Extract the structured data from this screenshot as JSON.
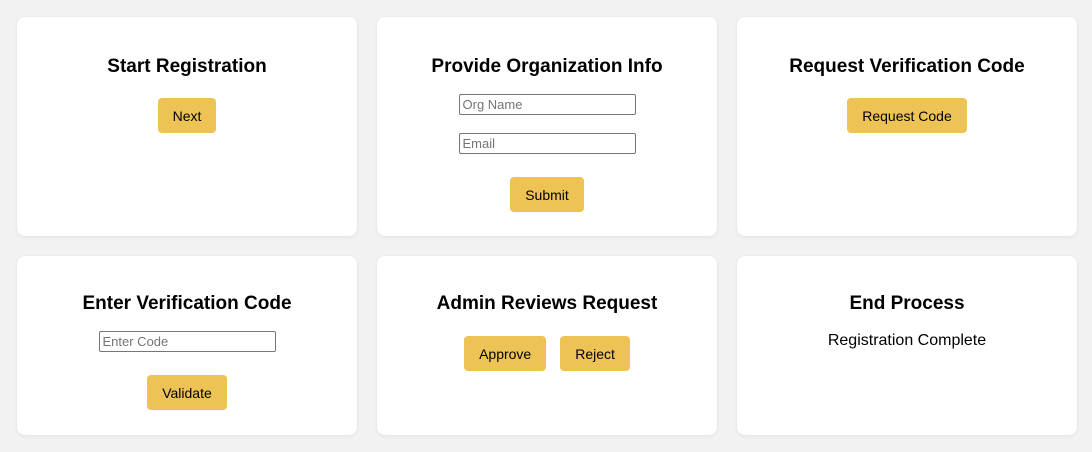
{
  "cards": {
    "start": {
      "title": "Start Registration",
      "next_label": "Next"
    },
    "org_info": {
      "title": "Provide Organization Info",
      "org_name_placeholder": "Org Name",
      "email_placeholder": "Email",
      "submit_label": "Submit"
    },
    "request_code": {
      "title": "Request Verification Code",
      "request_label": "Request Code"
    },
    "enter_code": {
      "title": "Enter Verification Code",
      "code_placeholder": "Enter Code",
      "validate_label": "Validate"
    },
    "admin_review": {
      "title": "Admin Reviews Request",
      "approve_label": "Approve",
      "reject_label": "Reject"
    },
    "end": {
      "title": "End Process",
      "status": "Registration Complete"
    }
  },
  "colors": {
    "button_bg": "#ecc354",
    "page_bg": "#f2f2f2",
    "card_bg": "#ffffff"
  }
}
